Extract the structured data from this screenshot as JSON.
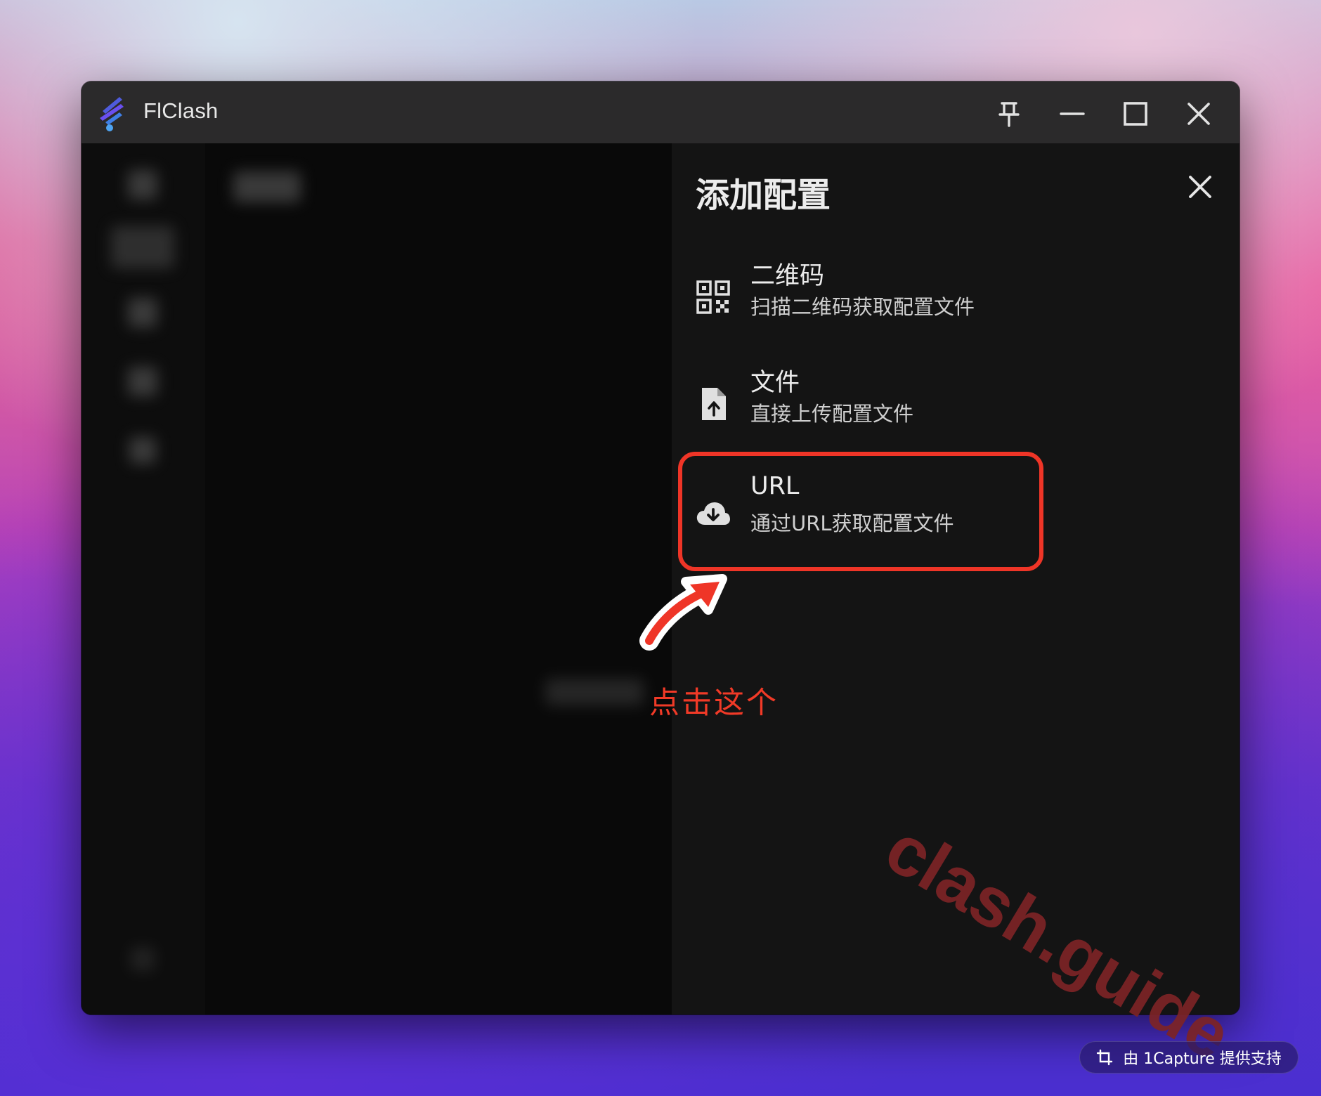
{
  "window": {
    "title": "FlClash",
    "controls": {
      "pin_icon": "pin-icon",
      "minimize_icon": "minimize-icon",
      "maximize_icon": "maximize-icon",
      "close_icon": "close-icon"
    }
  },
  "sheet": {
    "title": "添加配置",
    "close_icon": "close-icon",
    "options": [
      {
        "icon": "qr-code-icon",
        "title": "二维码",
        "subtitle": "扫描二维码获取配置文件"
      },
      {
        "icon": "file-upload-icon",
        "title": "文件",
        "subtitle": "直接上传配置文件"
      },
      {
        "icon": "cloud-download-icon",
        "title": "URL",
        "subtitle": "通过URL获取配置文件"
      }
    ]
  },
  "annotation": {
    "text": "点击这个",
    "color": "#f13a27",
    "arrow_icon": "arrow-icon"
  },
  "watermark": "clash.guide",
  "badge": {
    "icon": "crop-icon",
    "text": "由 1Capture 提供支持"
  },
  "colors": {
    "highlight": "#ef3527",
    "titlebar": "#2b2a2b",
    "sheet_bg": "#141414"
  }
}
